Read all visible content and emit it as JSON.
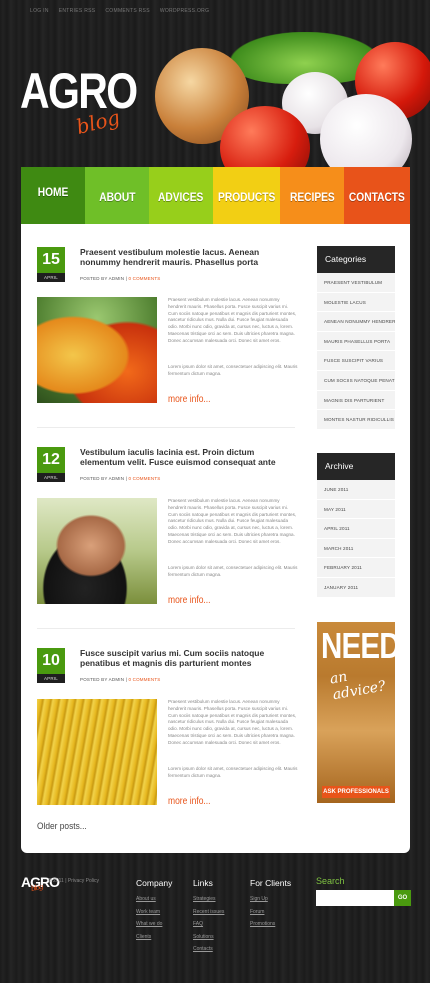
{
  "topbar": [
    "LOG IN",
    "ENTRIES RSS",
    "COMMENTS RSS",
    "WORDPRESS.ORG"
  ],
  "logo": {
    "main": "AGRO",
    "sub": "blog"
  },
  "nav": [
    {
      "label": "HOME",
      "color": "#3f8a12"
    },
    {
      "label": "ABOUT",
      "color": "#6fbf28"
    },
    {
      "label": "ADVICES",
      "color": "#97cf1b"
    },
    {
      "label": "PRODUCTS",
      "color": "#f2cf14"
    },
    {
      "label": "RECIPES",
      "color": "#f68e1a"
    },
    {
      "label": "CONTACTS",
      "color": "#e8531a"
    }
  ],
  "posts": [
    {
      "day": "15",
      "month": "APRIL",
      "title": "Praesent vestibulum molestie lacus. Aenean nonummy hendrerit mauris. Phasellus porta",
      "author": "POSTED BY ADMIN",
      "comments": "0 COMMENTS",
      "excerpt": "Praesent vestibulum molestie lacus. Aenean nonummy hendrerit mauris. Phasellus porta. Fusce suscipit varius mi. Cum sociis natoque penatibus et magnis dis parturient montes, nascetur ridiculus mus. Nulla dui. Fusce feugiat malesuada odio. Morbi nunc odio, gravida at, cursus nec, luctus a, lorem. Maecenas tristique orci ac sem. Duis ultricies pharetra magna. Donec accumsan malesuada orci. Donec sit amet eros.",
      "excerpt2": "Lorem ipsum dolor sit amet, consectetuer adipiscing elit. Mauris fermentum dictum magna.",
      "more": "more info..."
    },
    {
      "day": "12",
      "month": "APRIL",
      "title": "Vestibulum iaculis lacinia est. Proin dictum elementum velit. Fusce euismod consequat ante",
      "author": "POSTED BY ADMIN",
      "comments": "0 COMMENTS",
      "excerpt": "Praesent vestibulum molestie lacus. Aenean nonummy hendrerit mauris. Phasellus porta. Fusce suscipit varius mi. Cum sociis natoque penatibus et magnis dis parturient montes, nascetur ridiculus mus. Nulla dui. Fusce feugiat malesuada odio. Morbi nunc odio, gravida at, cursus nec, luctus a, lorem. Maecenas tristique orci ac sem. Duis ultricies pharetra magna. Donec accumsan malesuada orci. Donec sit amet eros.",
      "excerpt2": "Lorem ipsum dolor sit amet, consectetuer adipiscing elit. Mauris fermentum dictum magna.",
      "more": "more info..."
    },
    {
      "day": "10",
      "month": "APRIL",
      "title": "Fusce suscipit varius mi. Cum sociis natoque penatibus et magnis dis parturient montes",
      "author": "POSTED BY ADMIN",
      "comments": "0 COMMENTS",
      "excerpt": "Praesent vestibulum molestie lacus. Aenean nonummy hendrerit mauris. Phasellus porta. Fusce suscipit varius mi. Cum sociis natoque penatibus et magnis dis parturient montes, nascetur ridiculus mus. Nulla dui. Fusce feugiat malesuada odio. Morbi nunc odio, gravida at, cursus nec, luctus a, lorem. Maecenas tristique orci ac sem. Duis ultricies pharetra magna. Donec accumsan malesuada orci. Donec sit amet eros.",
      "excerpt2": "Lorem ipsum dolor sit amet, consectetuer adipiscing elit. Mauris fermentum dictum magna.",
      "more": "more info..."
    }
  ],
  "older": "Older posts...",
  "categories": {
    "title": "Categories",
    "items": [
      "PRAESENT VESTIBULUM",
      "MOLESTIE LACUS",
      "AENEAN NONUMMY HENDRERIT",
      "MAURIS PHASELLUS PORTA",
      "FUSCE SUSCIPIT VARIUS",
      "CUM SOCIIS NATOQUE PENATIBUS",
      "MAGNIS DIS PARTURIENT",
      "MONTES NASTUR RIDICULLIS"
    ]
  },
  "archive": {
    "title": "Archive",
    "items": [
      "JUNE 2011",
      "MAY 2011",
      "APRIL 2011",
      "MARCH 2011",
      "FEBRUARY 2011",
      "JANUARY 2011"
    ]
  },
  "ad": {
    "title": "NEED",
    "subtitle": "an advice?",
    "button": "ASK PROFESSIONALS"
  },
  "footer": {
    "logo": "AGRO",
    "logo_sub": "blog",
    "copyright": "© 2011 | Privacy Policy",
    "company": {
      "title": "Company",
      "links": [
        "About us",
        "Work team",
        "What we do",
        "Clients"
      ]
    },
    "links": {
      "title": "Links",
      "links": [
        "Strategies",
        "Recent issues",
        "FAQ",
        "Solutions",
        "Contacts"
      ]
    },
    "clients": {
      "title": "For Clients",
      "links": [
        "Sign Up",
        "Forum",
        "Promotions"
      ]
    },
    "search": {
      "title": "Search",
      "button": "GO",
      "placeholder": ""
    }
  }
}
